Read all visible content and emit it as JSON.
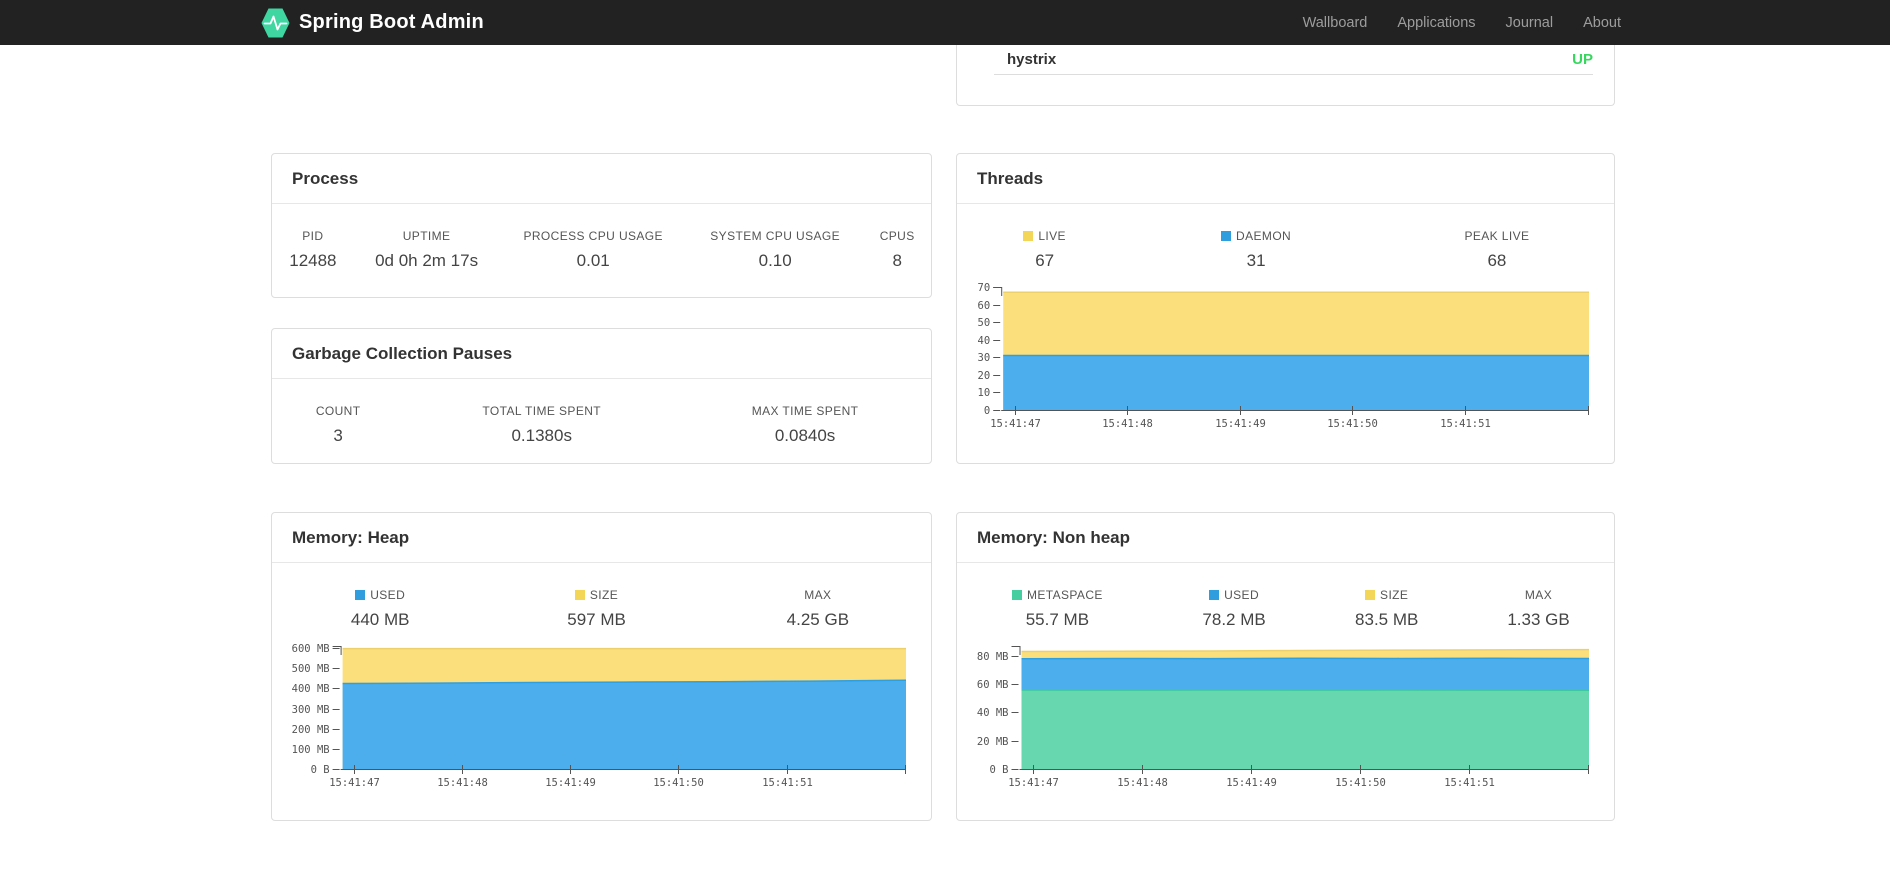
{
  "navbar": {
    "brand": "Spring Boot Admin",
    "items": [
      {
        "label": "Wallboard"
      },
      {
        "label": "Applications"
      },
      {
        "label": "Journal"
      },
      {
        "label": "About"
      }
    ]
  },
  "application_row": {
    "name": "hystrix",
    "status": "UP",
    "status_color": "#38d65f"
  },
  "cards": {
    "process": {
      "title": "Process",
      "stats": [
        {
          "label": "PID",
          "value": "12488"
        },
        {
          "label": "UPTIME",
          "value": "0d 0h 2m 17s"
        },
        {
          "label": "PROCESS CPU USAGE",
          "value": "0.01"
        },
        {
          "label": "SYSTEM CPU USAGE",
          "value": "0.10"
        },
        {
          "label": "CPUS",
          "value": "8"
        }
      ]
    },
    "gc": {
      "title": "Garbage Collection Pauses",
      "stats": [
        {
          "label": "COUNT",
          "value": "3"
        },
        {
          "label": "TOTAL TIME SPENT",
          "value": "0.1380s"
        },
        {
          "label": "MAX TIME SPENT",
          "value": "0.0840s"
        }
      ]
    },
    "threads": {
      "title": "Threads",
      "stats": [
        {
          "label": "LIVE",
          "value": "67",
          "marker": "#f3d558"
        },
        {
          "label": "DAEMON",
          "value": "31",
          "marker": "#2f9dde"
        },
        {
          "label": "PEAK LIVE",
          "value": "68"
        }
      ]
    },
    "heap": {
      "title": "Memory: Heap",
      "stats": [
        {
          "label": "USED",
          "value": "440 MB",
          "marker": "#2f9dde"
        },
        {
          "label": "SIZE",
          "value": "597 MB",
          "marker": "#f3d558"
        },
        {
          "label": "MAX",
          "value": "4.25 GB"
        }
      ]
    },
    "nonheap": {
      "title": "Memory: Non heap",
      "stats": [
        {
          "label": "METASPACE",
          "value": "55.7 MB",
          "marker": "#45cfa1"
        },
        {
          "label": "USED",
          "value": "78.2 MB",
          "marker": "#2f9dde"
        },
        {
          "label": "SIZE",
          "value": "83.5 MB",
          "marker": "#f3d558"
        },
        {
          "label": "MAX",
          "value": "1.33 GB"
        }
      ]
    }
  },
  "chart_data": [
    {
      "id": "threads",
      "type": "area",
      "title": "Threads",
      "stacked": true,
      "values_are_stack_tops": true,
      "x_tick_labels": [
        "15:41:47",
        "15:41:48",
        "15:41:49",
        "15:41:50",
        "15:41:51"
      ],
      "axis_max": 70,
      "y_ticks": [
        {
          "value": 0,
          "label": "0"
        },
        {
          "value": 10,
          "label": "10"
        },
        {
          "value": 20,
          "label": "20"
        },
        {
          "value": 30,
          "label": "30"
        },
        {
          "value": 40,
          "label": "40"
        },
        {
          "value": 50,
          "label": "50"
        },
        {
          "value": 60,
          "label": "60"
        },
        {
          "value": 70,
          "label": "70"
        }
      ],
      "series": [
        {
          "name": "DAEMON",
          "fill": "#4caeec",
          "line": "#2e9fe3",
          "values": [
            31,
            31,
            31,
            31,
            31,
            31,
            31
          ]
        },
        {
          "name": "LIVE",
          "fill": "#fcdf7d",
          "line": "#edd06a",
          "values": [
            67,
            67,
            67,
            67,
            67,
            67,
            67
          ]
        }
      ]
    },
    {
      "id": "heap",
      "type": "area",
      "title": "Memory: Heap",
      "stacked": true,
      "values_are_stack_tops": true,
      "x_tick_labels": [
        "15:41:47",
        "15:41:48",
        "15:41:49",
        "15:41:50",
        "15:41:51"
      ],
      "axis_max": 610,
      "y_ticks": [
        {
          "value": 0,
          "label": "0 B"
        },
        {
          "value": 100,
          "label": "100 MB"
        },
        {
          "value": 200,
          "label": "200 MB"
        },
        {
          "value": 300,
          "label": "300 MB"
        },
        {
          "value": 400,
          "label": "400 MB"
        },
        {
          "value": 500,
          "label": "500 MB"
        },
        {
          "value": 600,
          "label": "600 MB"
        }
      ],
      "series": [
        {
          "name": "USED",
          "fill": "#4caeec",
          "line": "#2e9fe3",
          "values": [
            424,
            426,
            429,
            431,
            433,
            436,
            440
          ]
        },
        {
          "name": "SIZE",
          "fill": "#fcdf7d",
          "line": "#edd06a",
          "values": [
            597,
            597,
            597,
            597,
            597,
            597,
            597
          ]
        }
      ]
    },
    {
      "id": "nonheap",
      "type": "area",
      "title": "Memory: Non heap",
      "stacked": true,
      "values_are_stack_tops": true,
      "x_tick_labels": [
        "15:41:47",
        "15:41:48",
        "15:41:49",
        "15:41:50",
        "15:41:51"
      ],
      "axis_max": 87,
      "y_ticks": [
        {
          "value": 0,
          "label": "0 B"
        },
        {
          "value": 20,
          "label": "20 MB"
        },
        {
          "value": 40,
          "label": "40 MB"
        },
        {
          "value": 60,
          "label": "60 MB"
        },
        {
          "value": 80,
          "label": "80 MB"
        }
      ],
      "series": [
        {
          "name": "METASPACE",
          "fill": "#66d7af",
          "line": "#3fc89a",
          "values": [
            55.9,
            55.8,
            55.9,
            55.8,
            55.9,
            55.8,
            55.7
          ]
        },
        {
          "name": "USED",
          "fill": "#4caeec",
          "line": "#2e9fe3",
          "values": [
            78.0,
            78.2,
            78.1,
            78.3,
            78.2,
            78.3,
            78.2
          ]
        },
        {
          "name": "SIZE",
          "fill": "#fcdf7d",
          "line": "#edd06a",
          "values": [
            83.1,
            83.3,
            83.5,
            83.8,
            84.1,
            84.3,
            84.4
          ]
        }
      ]
    }
  ]
}
